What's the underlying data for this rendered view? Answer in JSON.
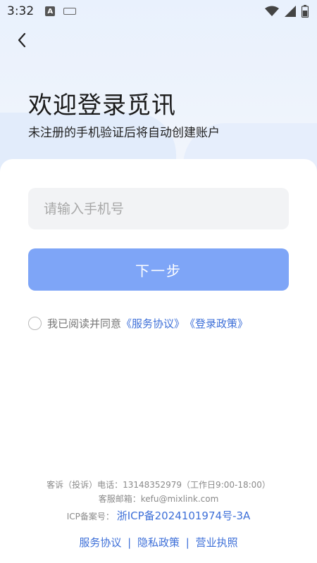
{
  "status_bar": {
    "time": "3:32",
    "a_badge": "A"
  },
  "page": {
    "title": "欢迎登录觅讯",
    "subtitle": "未注册的手机验证后将自动创建账户"
  },
  "form": {
    "phone_placeholder": "请输入手机号",
    "phone_value": "",
    "next_label": "下一步"
  },
  "agreement": {
    "prefix": "我已阅读并同意",
    "service_link": "《服务协议》",
    "privacy_link": "《登录政策》"
  },
  "footer": {
    "complaint": "客诉（投诉）电话：13148352979（工作日9:00-18:00）",
    "email": "客服邮箱：kefu@mixlink.com",
    "icp_label": "ICP备案号：",
    "icp_number": "浙ICP备2024101974号-3A",
    "links": [
      "服务协议",
      "隐私政策",
      "营业执照"
    ],
    "separator": "|"
  },
  "colors": {
    "accent": "#3d6fd8",
    "button": "#7ea5f7"
  }
}
